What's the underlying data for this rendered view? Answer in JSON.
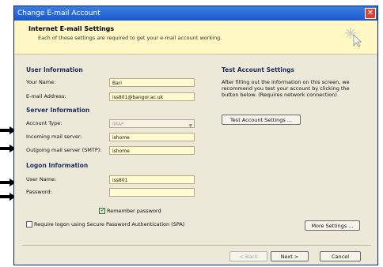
{
  "window": {
    "title": "Change E-mail Account",
    "close": "✕"
  },
  "header": {
    "title": "Internet E-mail Settings",
    "subtitle": "Each of these settings are required to get your e-mail account working."
  },
  "user_info": {
    "heading": "User Information",
    "name_label": "Your Name:",
    "name_value": "Bari",
    "email_label": "E-mail Address:",
    "email_value": "iss801@bangor.ac.uk"
  },
  "server_info": {
    "heading": "Server Information",
    "account_type_label": "Account Type:",
    "account_type_value": "IMAP",
    "incoming_label": "Incoming mail server:",
    "incoming_value": "ishome",
    "outgoing_label": "Outgoing mail server (SMTP):",
    "outgoing_value": "ishome"
  },
  "logon_info": {
    "heading": "Logon Information",
    "user_label": "User Name:",
    "user_value": "iss801",
    "password_label": "Password:",
    "password_value": "",
    "remember_label": "Remember password",
    "remember_checked": true,
    "spa_label": "Require logon using Secure Password Authentication (SPA)",
    "spa_checked": false
  },
  "test": {
    "heading": "Test Account Settings",
    "description": "After filling out the information on this screen, we recommend you test your account by clicking the button below. (Requires network connection)",
    "button": "Test Account Settings ..."
  },
  "buttons": {
    "more_settings": "More Settings ...",
    "back": "< Back",
    "next": "Next >",
    "cancel": "Cancel"
  }
}
